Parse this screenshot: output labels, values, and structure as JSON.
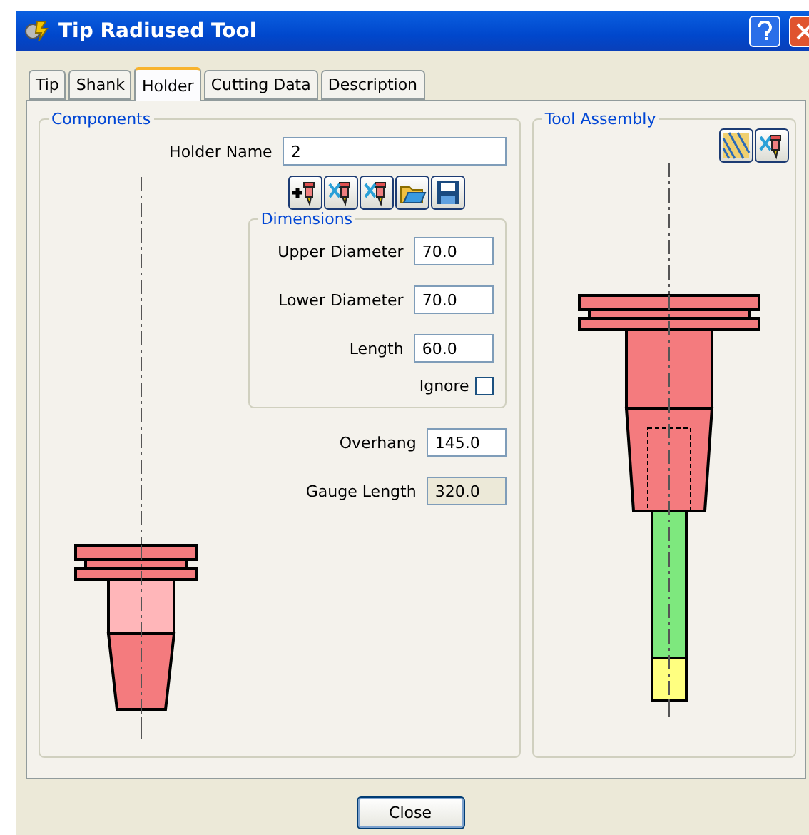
{
  "window": {
    "title": "Tip Radiused Tool"
  },
  "tabs": [
    {
      "label": "Tip",
      "selected": false
    },
    {
      "label": "Shank",
      "selected": false
    },
    {
      "label": "Holder",
      "selected": true
    },
    {
      "label": "Cutting Data",
      "selected": false
    },
    {
      "label": "Description",
      "selected": false
    }
  ],
  "components": {
    "title": "Components",
    "holder_name": {
      "label": "Holder Name",
      "value": "2"
    },
    "dimensions": {
      "title": "Dimensions",
      "fields": [
        {
          "label": "Upper Diameter",
          "value": "70.0"
        },
        {
          "label": "Lower Diameter",
          "value": "70.0"
        },
        {
          "label": "Length",
          "value": "60.0"
        }
      ],
      "ignore": {
        "label": "Ignore",
        "checked": false
      }
    },
    "fields": [
      {
        "label": "Overhang",
        "value": "145.0",
        "disabled": false
      },
      {
        "label": "Gauge Length",
        "value": "320.0",
        "disabled": true
      }
    ]
  },
  "tool_assembly": {
    "title": "Tool Assembly"
  },
  "buttons": [
    "Close"
  ]
}
